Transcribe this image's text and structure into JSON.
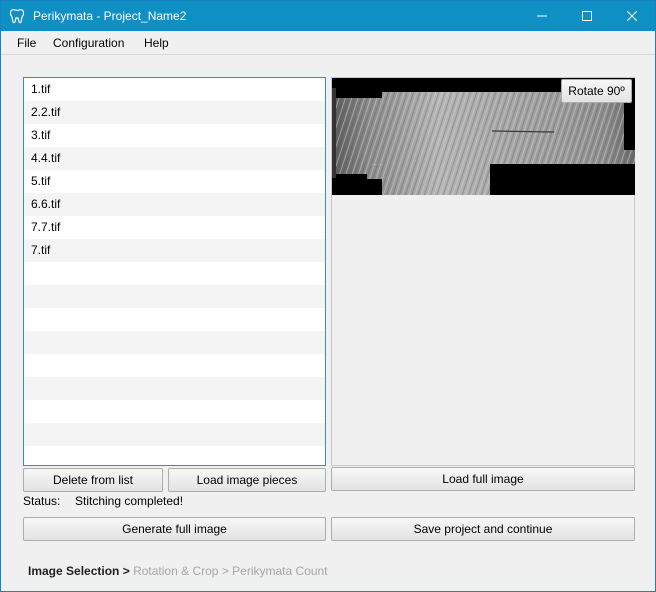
{
  "window": {
    "title": "Perikymata - Project_Name2",
    "controls": {
      "minimize": "minimize",
      "maximize": "maximize",
      "close": "close"
    }
  },
  "menu": [
    "File",
    "Configuration",
    "Help"
  ],
  "files": [
    "1.tif",
    "2.2.tif",
    "3.tif",
    "4.4.tif",
    "5.tif",
    "6.6.tif",
    "7.7.tif",
    "7.tif"
  ],
  "buttons": {
    "delete": "Delete from list",
    "load_pieces": "Load image pieces",
    "load_full": "Load full image",
    "generate": "Generate full image",
    "save_continue": "Save project and continue",
    "rotate": "Rotate 90º"
  },
  "status": {
    "label": "Status:",
    "value": "Stitching completed!"
  },
  "breadcrumb": {
    "current": "Image Selection",
    "separator": ">",
    "step2": "Rotation & Crop",
    "step3": "Perikymata Count"
  },
  "colors": {
    "titlebar": "#0e90c4",
    "accent_border": "#2f8ecf",
    "inactive_text": "#a5a5a5"
  },
  "icons": {
    "app": "tooth-icon"
  }
}
